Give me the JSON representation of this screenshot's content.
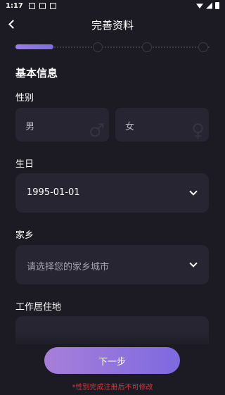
{
  "status_bar": {
    "time": "1:17"
  },
  "header": {
    "title": "完善资料"
  },
  "section": {
    "basic_info": "基本信息"
  },
  "gender": {
    "label": "性别",
    "male": "男",
    "female": "女",
    "male_symbol": "♂",
    "female_symbol": "♀"
  },
  "birthday": {
    "label": "生日",
    "value": "1995-01-01"
  },
  "hometown": {
    "label": "家乡",
    "placeholder": "请选择您的家乡城市"
  },
  "work_location": {
    "label": "工作居住地"
  },
  "footer": {
    "next_button": "下一步",
    "notice": "*性别完成注册后不可修改"
  },
  "colors": {
    "background": "#1c1b24",
    "card": "#262531",
    "accent": "#8b74e0",
    "warning": "#e0333a"
  }
}
